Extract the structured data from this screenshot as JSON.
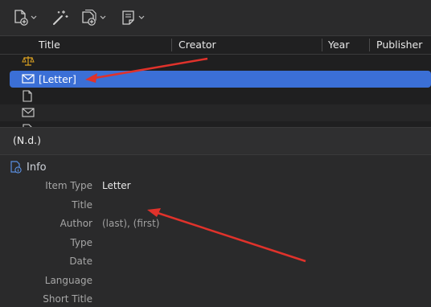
{
  "toolbar": {
    "buttons": [
      {
        "name": "new-item-button",
        "icon": "new-document-icon",
        "has_menu": true
      },
      {
        "name": "magic-wand-button",
        "icon": "magic-wand-icon",
        "has_menu": false
      },
      {
        "name": "add-attachment-button",
        "icon": "attachment-add-icon",
        "has_menu": true
      },
      {
        "name": "new-note-button",
        "icon": "note-icon",
        "has_menu": true
      }
    ]
  },
  "table": {
    "columns": [
      "Title",
      "Creator",
      "Year",
      "Publisher"
    ],
    "rows": [
      {
        "icon": "scales-icon",
        "title": "",
        "selected": false
      },
      {
        "icon": "envelope-icon",
        "title": "[Letter]",
        "selected": true
      },
      {
        "icon": "document-icon",
        "title": "",
        "selected": false
      },
      {
        "icon": "envelope-icon",
        "title": "",
        "selected": false
      },
      {
        "icon": "document-icon",
        "title": "",
        "selected": false
      }
    ]
  },
  "item_pane": {
    "header": "(N.d.)",
    "section_title": "Info",
    "fields": [
      {
        "label": "Item Type",
        "value": "Letter"
      },
      {
        "label": "Title",
        "value": ""
      },
      {
        "label": "Author",
        "value": "(last), (first)"
      },
      {
        "label": "Type",
        "value": ""
      },
      {
        "label": "Date",
        "value": ""
      },
      {
        "label": "Language",
        "value": ""
      },
      {
        "label": "Short Title",
        "value": ""
      }
    ]
  },
  "colors": {
    "selection": "#3b6fd6",
    "annotation_arrow": "#e0322b",
    "scales_icon": "#d9a020"
  }
}
